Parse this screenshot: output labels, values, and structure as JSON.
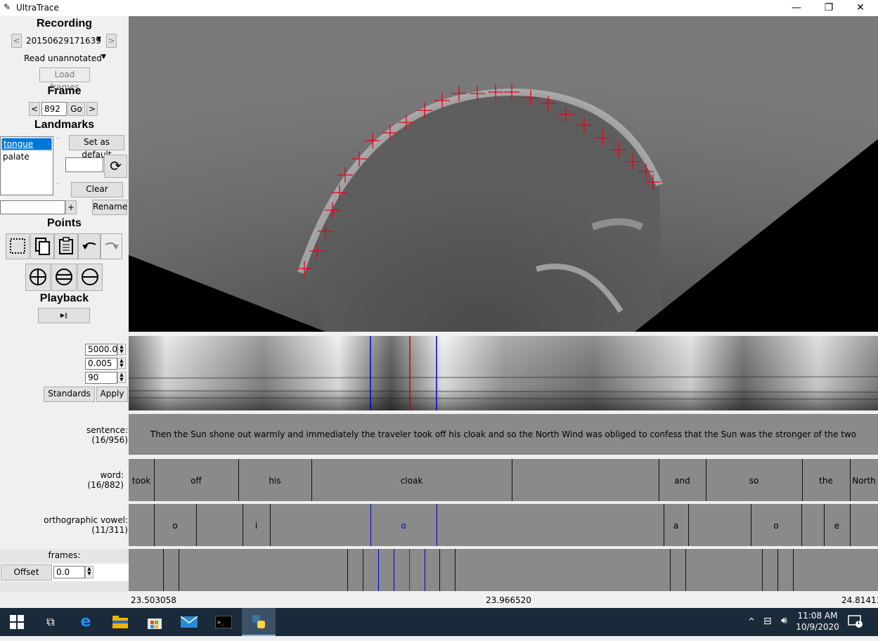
{
  "window": {
    "title": "UltraTrace",
    "minimize_icon": "—",
    "restore_icon": "❐",
    "close_icon": "✕"
  },
  "recording": {
    "heading": "Recording",
    "prev": "<",
    "next": ">",
    "selected": "20150629171639",
    "filter": "Read unannotated",
    "load_frames": "Load frames"
  },
  "frame": {
    "heading": "Frame",
    "prev": "<",
    "value": "892",
    "go": "Go",
    "next": ">"
  },
  "landmarks": {
    "heading": "Landmarks",
    "items": [
      "tongue",
      "palate"
    ],
    "selected": "tongue",
    "set_default": "Set as default",
    "clear": "Clear",
    "add": "+",
    "rename": "Rename"
  },
  "points": {
    "heading": "Points"
  },
  "playback": {
    "heading": "Playback",
    "play_icon": "▶‖"
  },
  "spectrogram": {
    "controls": [
      "5000.0",
      "0.005",
      "90"
    ],
    "standards": "Standards",
    "apply": "Apply"
  },
  "tiers": {
    "sentence": {
      "label": "sentence:",
      "count": "(16/956)",
      "text": "Then the Sun shone out warmly and immediately the traveler took off his cloak and so the North Wind was obliged to confess that the Sun was the stronger of the two"
    },
    "word": {
      "label": "word:",
      "count": "(16/882)",
      "words": [
        "took",
        "off",
        "his",
        "cloak",
        "and",
        "so",
        "the",
        "North"
      ]
    },
    "vowel": {
      "label": "orthographic vowel:",
      "count": "(11/311)",
      "vowels": [
        "o",
        "i",
        "o",
        "a",
        "o",
        "e"
      ]
    },
    "frames": {
      "label": "frames:",
      "offset_button": "Offset",
      "offset_value": "0.0"
    }
  },
  "times": {
    "start": "23.503058",
    "middle": "23.966520",
    "end": "24.814119"
  },
  "taskbar": {
    "time": "11:08 AM",
    "date": "10/9/2020",
    "notification_count": "1"
  },
  "colors": {
    "trace": "#e8001a",
    "selection": "#0000cc",
    "cursor": "#cc0000",
    "tier_bg": "#8a8a8a"
  }
}
